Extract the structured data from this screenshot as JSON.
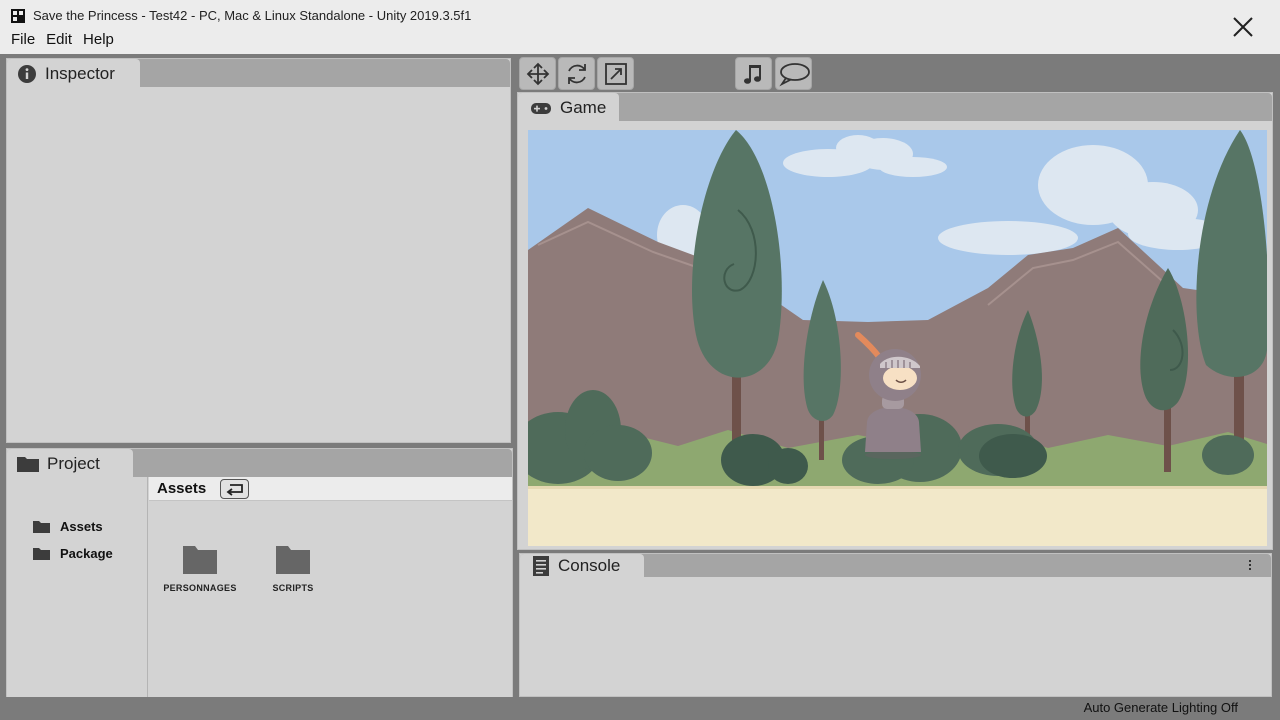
{
  "window": {
    "title": "Save the Princess - Test42 - PC, Mac & Linux Standalone - Unity 2019.3.5f1",
    "close_icon": "close-icon"
  },
  "menu": [
    "File",
    "Edit",
    "Help"
  ],
  "inspector": {
    "tab_label": "Inspector",
    "icon": "info-icon"
  },
  "project": {
    "tab_label": "Project",
    "icon": "folder-icon",
    "sidebar": [
      {
        "label": "Assets",
        "icon": "folder-icon"
      },
      {
        "label": "Package",
        "icon": "folder-icon"
      }
    ],
    "breadcrumb": "Assets",
    "back_icon": "return-arrow-icon",
    "items": [
      {
        "label": "PERSONNAGES",
        "icon": "folder-icon"
      },
      {
        "label": "SCRIPTS",
        "icon": "folder-icon"
      }
    ]
  },
  "toolbar": {
    "tools": [
      "move-icon",
      "rotate-icon",
      "scale-icon"
    ],
    "toggles": [
      "music-note-icon",
      "speech-bubble-icon"
    ]
  },
  "game": {
    "tab_label": "Game",
    "icon": "gamepad-icon"
  },
  "console": {
    "tab_label": "Console",
    "icon": "document-icon",
    "menu_icon": "more-vertical-icon"
  },
  "status": {
    "text": "Auto Generate Lighting Off"
  },
  "colors": {
    "window_bg": "#ececec",
    "panel_bg": "#d3d3d3",
    "tabstrip_bg": "#a5a5a5",
    "workspace_bg": "#7b7b7b",
    "sky": "#a9c8ea",
    "ground": "#f2e8c9",
    "tree": "#577565",
    "mountain": "#8f7b79"
  }
}
